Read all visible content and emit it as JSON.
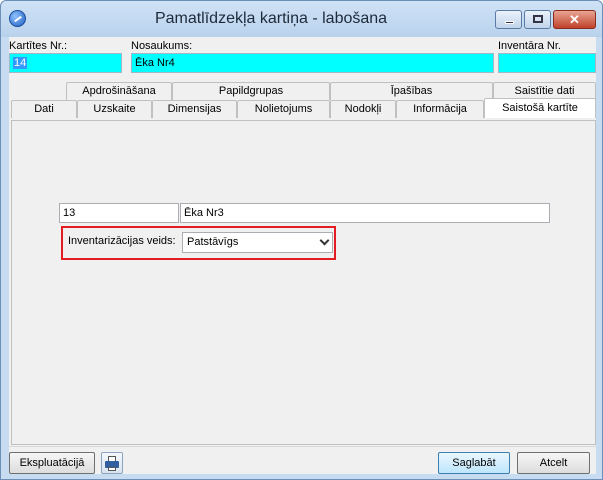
{
  "window": {
    "title": "Pamatlīdzekļa kartiņa - labošana",
    "close_glyph": "✕"
  },
  "header": {
    "card_no_label": "Kartītes Nr.:",
    "card_no_value": "14",
    "name_label": "Nosaukums:",
    "name_value": "Ēka Nr4",
    "inventory_label": "Inventāra Nr.",
    "inventory_value": ""
  },
  "tabs": {
    "row1": [
      "Apdrošināšana",
      "Papildgrupas",
      "Īpašības",
      "Saistītie dati"
    ],
    "row2": [
      "Dati",
      "Uzskaite",
      "Dimensijas",
      "Nolietojums",
      "Nodokļi",
      "Informācija",
      "Saistošā kartīte"
    ],
    "active": "Saistošā kartīte"
  },
  "linked_card": {
    "number": "13",
    "name": "Ēka Nr3",
    "inventory_type_label": "Inventarizācijas veids:",
    "inventory_type_value": "Patstāvīgs"
  },
  "footer": {
    "exploitation_label": "Ekspluatācijā",
    "save_label": "Saglabāt",
    "cancel_label": "Atcelt"
  },
  "colors": {
    "highlight_field": "#00ffff",
    "selection": "#3399ff",
    "callout_border": "#e31b23"
  }
}
